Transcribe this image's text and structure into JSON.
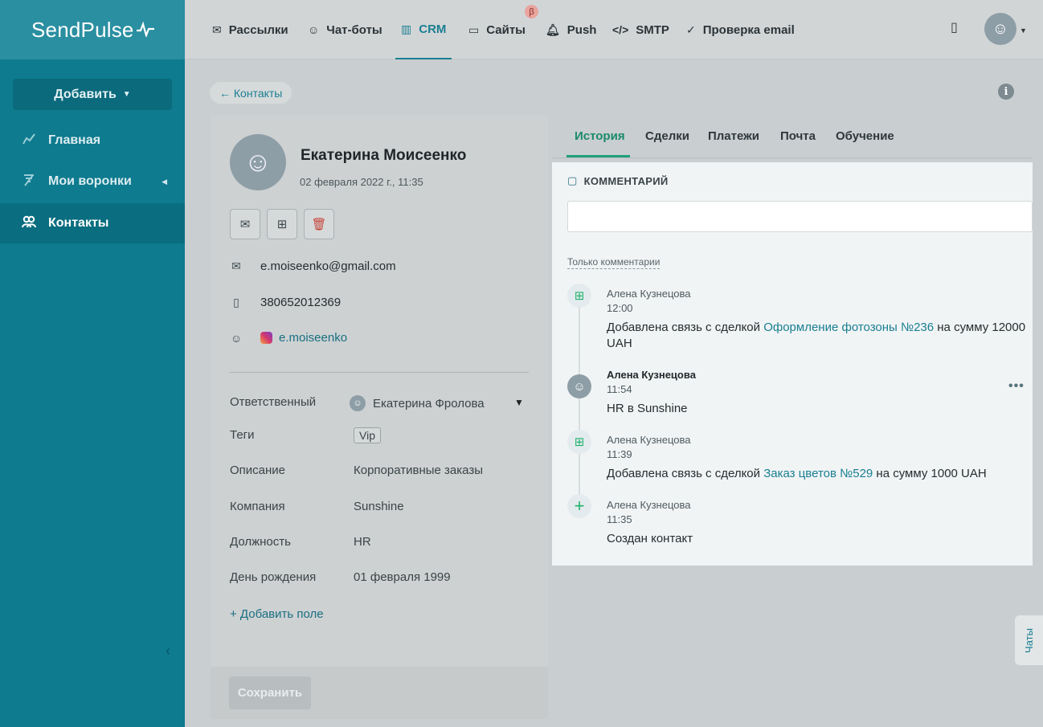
{
  "app": {
    "logo": "SendPulse",
    "logo_mark": "-√∕"
  },
  "sidebar": {
    "add_label": "Добавить",
    "items": [
      {
        "label": "Главная"
      },
      {
        "label": "Мои воронки"
      },
      {
        "label": "Контакты"
      }
    ]
  },
  "topnav": {
    "tabs": [
      {
        "label": "Рассылки"
      },
      {
        "label": "Чат-боты"
      },
      {
        "label": "CRM"
      },
      {
        "label": "Сайты"
      },
      {
        "label": "Push"
      },
      {
        "label": "SMTP"
      },
      {
        "label": "Проверка email"
      }
    ],
    "beta_label": "β",
    "active_tab": "CRM"
  },
  "page": {
    "back_label": "← Контакты",
    "info_label": "i"
  },
  "contact": {
    "name": "Екатерина Моисеенко",
    "created": "02 февраля 2022 г., 11:35",
    "email": "e.moiseenko@gmail.com",
    "phone": "380652012369",
    "instagram": "e.moiseenko",
    "fields": [
      {
        "label": "Ответственный",
        "value": "Екатерина Фролова"
      },
      {
        "label": "Теги",
        "value": "Vip"
      },
      {
        "label": "Описание",
        "value": "Корпоративные заказы"
      },
      {
        "label": "Компания",
        "value": "Sunshine"
      },
      {
        "label": "Должность",
        "value": "HR"
      },
      {
        "label": "День рождения",
        "value": "01 февраля 1999"
      }
    ],
    "add_field_label": "+ Добавить поле",
    "save_label": "Сохранить"
  },
  "right_tabs": [
    {
      "label": "История"
    },
    {
      "label": "Сделки"
    },
    {
      "label": "Платежи"
    },
    {
      "label": "Почта"
    },
    {
      "label": "Обучение"
    }
  ],
  "history": {
    "comment_title": "КОММЕНТАРИЙ",
    "comment_placeholder": "",
    "only_comments_label": "Только комментарии",
    "events": [
      {
        "author": "Алена Кузнецова",
        "time": "12:00",
        "text_before": "Добавлена связь с сделкой ",
        "link": "Оформление фотозоны №236",
        "text_after": " на сумму 12000 UAH"
      },
      {
        "author": "Алена Кузнецова",
        "time": "11:54",
        "text": "HR в Sunshine"
      },
      {
        "author": "Алена Кузнецова",
        "time": "11:39",
        "text_before": "Добавлена связь с сделкой ",
        "link": "Заказ цветов №529",
        "text_after": " на сумму 1000 UAH"
      },
      {
        "author": "Алена Кузнецова",
        "time": "11:35",
        "text": "Создан контакт"
      }
    ],
    "more_label": "•••"
  },
  "chats_label": "Чаты",
  "colors": {
    "brand": "#0e7b8f",
    "accent": "#1a7f92",
    "success": "#22b26a",
    "danger": "#c6453b"
  }
}
